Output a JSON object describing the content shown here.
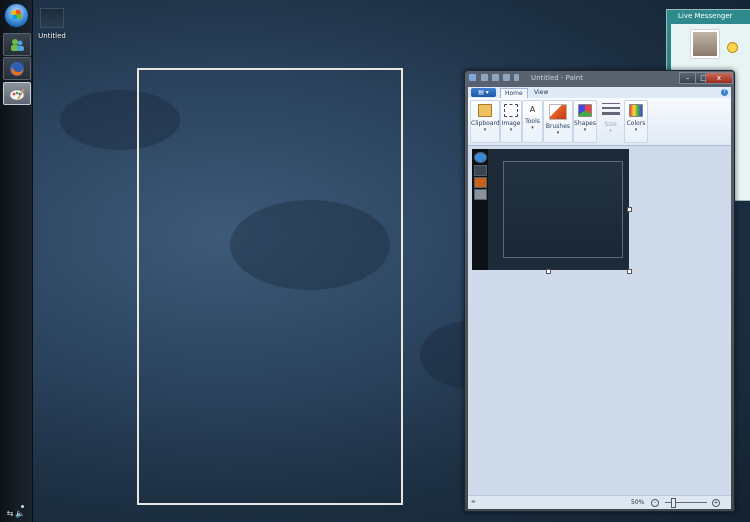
{
  "desktop": {
    "icon_label": "Untitled"
  },
  "taskbar": {
    "items": [
      {
        "name": "start-orb"
      },
      {
        "name": "live-messenger"
      },
      {
        "name": "firefox"
      },
      {
        "name": "paint"
      }
    ]
  },
  "messenger": {
    "title": "Live Messenger"
  },
  "paint": {
    "title": "Untitled - Paint",
    "tabs": [
      "Home",
      "View"
    ],
    "groups": [
      "Clipboard",
      "Image",
      "Tools",
      "Brushes",
      "Shapes",
      "Size",
      "Colors"
    ],
    "zoom_label": "50%",
    "caption_buttons": [
      "–",
      "□",
      "x"
    ]
  },
  "colors": {
    "accent": "#3a7fd4",
    "ribbon_bg": "#e1eaf4",
    "canvas_bg": "#cfdbea"
  }
}
